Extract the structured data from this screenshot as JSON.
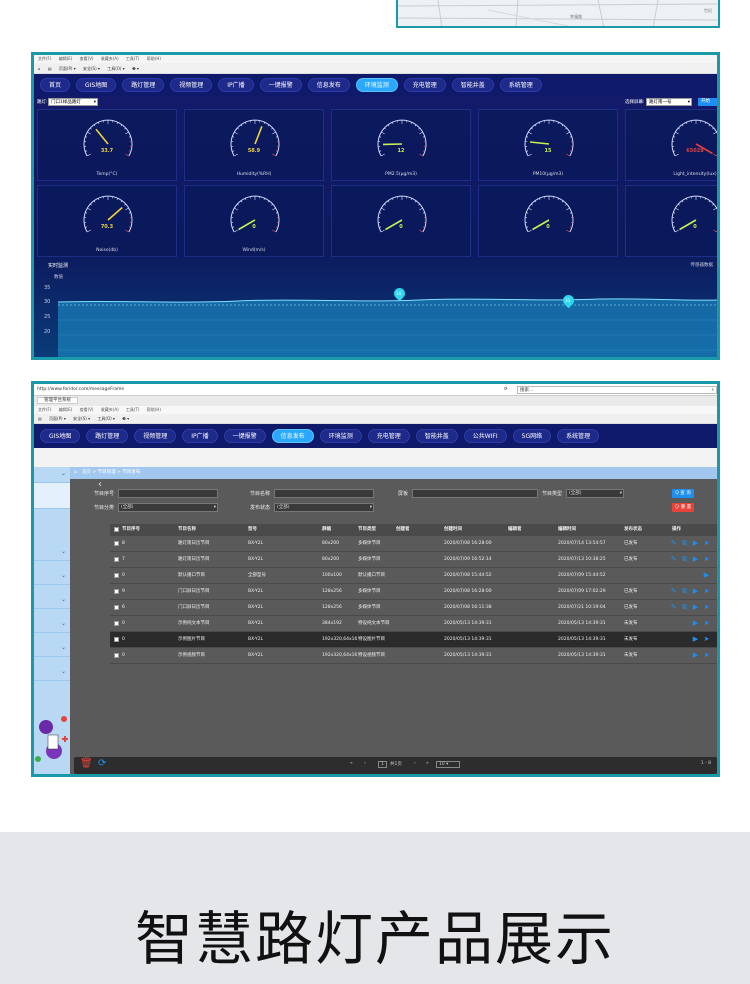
{
  "colors": {
    "accent": "#1a9aa8",
    "nav_bg": "#0f1a6b",
    "nav_active": "#2aa7ff",
    "banner_bg": "#e5e6ea"
  },
  "top_map": {
    "street_label": "幸福路",
    "edge_label": "世纪"
  },
  "screen1": {
    "menubar": [
      "文件(F)",
      "编辑(E)",
      "查看(V)",
      "收藏夹(A)",
      "工具(T)",
      "帮助(H)"
    ],
    "toolbar": [
      "页面(P) ▾",
      "安全(S) ▾",
      "工具(O) ▾",
      "❷ ▾"
    ],
    "nav": [
      "首页",
      "GIS地图",
      "路灯管理",
      "视频管理",
      "IP广播",
      "一键报警",
      "信息发布",
      "环境监测",
      "充电管理",
      "智能井盖",
      "系统管理"
    ],
    "active_nav": "环境监测",
    "device_label": "路灯:",
    "device_select": "门口1样品路灯",
    "right_label": "选择屏幕:",
    "right_select": "路灯南一号",
    "right_button": "开始",
    "gauges": [
      {
        "label": "Temp(°C)",
        "value": "33.7",
        "color": "#f0d23c"
      },
      {
        "label": "Humidity(%RH)",
        "value": "58.9",
        "color": "#f0d23c"
      },
      {
        "label": "PM2.5(μg/m3)",
        "value": "12",
        "color": "#c8f050"
      },
      {
        "label": "PM10(μg/m3)",
        "value": "15",
        "color": "#c8f050"
      },
      {
        "label": "Light_intensity(lux)",
        "value": "65028",
        "color": "#e04040"
      },
      {
        "label": "Noise(db)",
        "value": "70.3",
        "color": "#f0d23c"
      },
      {
        "label": "Wind(m/s)",
        "value": "0",
        "color": "#c8f050"
      },
      {
        "label": "",
        "value": "0",
        "color": "#c8f050"
      },
      {
        "label": "",
        "value": "0",
        "color": "#c8f050"
      },
      {
        "label": "",
        "value": "0",
        "color": "#c8f050"
      }
    ],
    "realtime": {
      "title": "实时监测",
      "unit": "数值",
      "ticks": [
        "35",
        "30",
        "25",
        "20"
      ],
      "legend": "传感器数据",
      "marker1": "34",
      "marker2": "33"
    }
  },
  "screen2": {
    "url": "http://www.foridor.com/messageFrame",
    "search_placeholder": "搜索...",
    "tab_title": "管理平台系统",
    "menubar": [
      "文件(F)",
      "编辑(E)",
      "查看(V)",
      "收藏夹(A)",
      "工具(T)",
      "帮助(H)"
    ],
    "toolbar": [
      "页面(P) ▾",
      "安全(S) ▾",
      "工具(O) ▾",
      "❷ ▾"
    ],
    "nav": [
      "GIS地图",
      "路灯管理",
      "视频管理",
      "IP广播",
      "一键报警",
      "信息发布",
      "环境监测",
      "充电管理",
      "智能井盖",
      "公共WIFI",
      "5G网络",
      "系统管理"
    ],
    "active_nav": "信息发布",
    "breadcrumb": "首页 > 节目管理 > 节目发布",
    "filters": {
      "program_no": "节目序号",
      "program_name": "节目名称",
      "screen": "屏板",
      "program_type": "节目类型",
      "program_type_value": "(全部)",
      "category": "节目分类",
      "category_value": "(全部)",
      "status": "发布状态",
      "status_value": "(全部)",
      "query": "Q 查 询",
      "reset": "ひ 重 置"
    },
    "columns": [
      "节目序号",
      "节目名称",
      "型号",
      "屏幅",
      "节目类型",
      "创建者",
      "创建时间",
      "编辑者",
      "编辑时间",
      "发布状态",
      "操作"
    ],
    "rows": [
      {
        "no": "8",
        "name": "路灯南日历节目",
        "model": "BX-Y2L",
        "size": "80x200",
        "type": "多媒体节目",
        "created": "2020/07/08 16:28:00",
        "edited": "2020/07/14 13:54:57",
        "status": "已发布"
      },
      {
        "no": "7",
        "name": "路灯南日历节目",
        "model": "BX-Y2L",
        "size": "80x200",
        "type": "多媒体节目",
        "created": "2020/07/09 16:52:14",
        "edited": "2020/07/13 10:38:25",
        "status": "已发布"
      },
      {
        "no": "0",
        "name": "默认播口节目",
        "model": "全部型号",
        "size": "100x100",
        "type": "默认播口节目",
        "created": "2020/07/08 15:44:52",
        "edited": "2020/07/09 15:44:52",
        "status": ""
      },
      {
        "no": "9",
        "name": "门口屏日历节目",
        "model": "BX-Y2L",
        "size": "128x256",
        "type": "多媒体节目",
        "created": "2020/07/08 16:28:00",
        "edited": "2020/07/09 17:02:29",
        "status": "已发布"
      },
      {
        "no": "6",
        "name": "门口屏日历节目",
        "model": "BX-Y2L",
        "size": "128x256",
        "type": "多媒体节目",
        "created": "2020/07/08 16:11:38",
        "edited": "2020/07/21 10:19:04",
        "status": "已发布"
      },
      {
        "no": "0",
        "name": "示例纯文本节目",
        "model": "BX-Y2L",
        "size": "384x192",
        "type": "特设纯文本节目",
        "created": "2020/05/13 14:39:31",
        "edited": "2020/05/13 14:39:31",
        "status": "未发布"
      },
      {
        "no": "0",
        "name": "示例图片节目",
        "model": "BX-Y2L",
        "size": "192x320,64x16",
        "type": "特设图片节目",
        "created": "2020/05/13 14:39:31",
        "edited": "2020/05/13 14:39:31",
        "status": "未发布"
      },
      {
        "no": "0",
        "name": "示例视频节目",
        "model": "BX-Y2L",
        "size": "192x320,64x16",
        "type": "特设视频节目",
        "created": "2020/05/13 14:39:31",
        "edited": "2020/05/13 14:39:31",
        "status": "未发布"
      }
    ],
    "pager": {
      "page": "1",
      "of": "共1页",
      "per_page": "10",
      "range": "1 - 8"
    }
  },
  "banner": {
    "title": "智慧路灯产品展示"
  }
}
